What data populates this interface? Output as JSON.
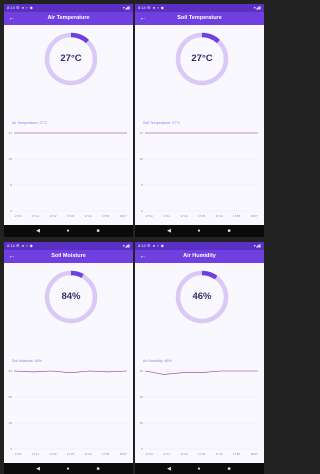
{
  "status_time": "8:14",
  "screens": [
    {
      "title": "Air Temperature",
      "gauge_value": "27°C",
      "gauge_fraction": 0.12,
      "chart_label": "Air Temperature: 27°C",
      "chart_data": {
        "type": "line",
        "yticks": [
          "27",
          "18",
          "9",
          "0"
        ],
        "xticks": [
          "17:04",
          "17:11",
          "17:22",
          "17:33",
          "17:44",
          "17:55",
          "18:07"
        ],
        "ylim": [
          0,
          27
        ],
        "values": [
          27,
          27,
          27,
          27,
          27,
          27,
          27
        ]
      }
    },
    {
      "title": "Soil Temperature",
      "gauge_value": "27°C",
      "gauge_fraction": 0.12,
      "chart_label": "Soil Temperature: 27°C",
      "chart_data": {
        "type": "line",
        "yticks": [
          "27",
          "18",
          "9",
          "0"
        ],
        "xticks": [
          "17:04",
          "17:11",
          "17:22",
          "17:33",
          "17:44",
          "17:55",
          "18:07"
        ],
        "ylim": [
          0,
          27
        ],
        "values": [
          27,
          27,
          27,
          27,
          27,
          27,
          27
        ]
      }
    },
    {
      "title": "Soil Moisture",
      "gauge_value": "84%",
      "gauge_fraction": 0.08,
      "chart_label": "Soil Moisture: 84%",
      "chart_data": {
        "type": "line",
        "yticks": [
          "84",
          "56",
          "28",
          "0"
        ],
        "xticks": [
          "17:04",
          "17:11",
          "17:22",
          "17:33",
          "17:44",
          "17:55",
          "18:07"
        ],
        "ylim": [
          0,
          84
        ],
        "values": [
          84,
          83,
          84,
          82,
          84,
          83,
          84
        ]
      }
    },
    {
      "title": "Air Humidity",
      "gauge_value": "46%",
      "gauge_fraction": 0.1,
      "chart_label": "Air Humidity: 46%",
      "chart_data": {
        "type": "line",
        "yticks": [
          "46",
          "30",
          "15",
          "0"
        ],
        "xticks": [
          "17:04",
          "17:11",
          "17:22",
          "17:33",
          "17:44",
          "17:55",
          "18:07"
        ],
        "ylim": [
          0,
          46
        ],
        "values": [
          46,
          44,
          45,
          45,
          46,
          46,
          46
        ]
      }
    }
  ],
  "navbar": {
    "back": "◀",
    "home": "●",
    "recent": "■"
  },
  "colors": {
    "accent": "#6f3fe0",
    "ring_track": "#d9c9f7",
    "ring_fill": "#6f3fe0",
    "line": "#8a3a8a"
  }
}
